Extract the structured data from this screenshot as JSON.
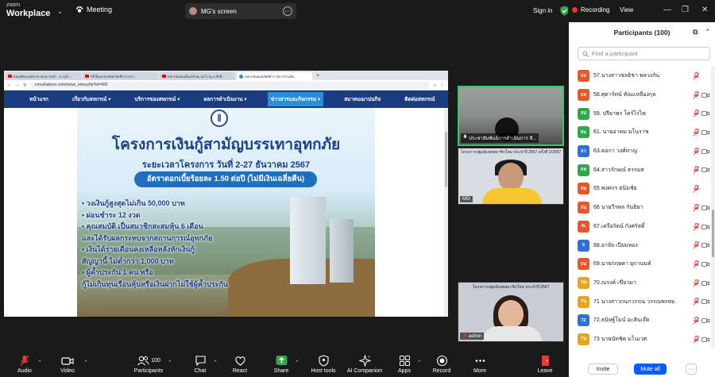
{
  "topbar": {
    "brand_small": "zoom",
    "brand_big": "Workplace",
    "meeting_label": "Meeting",
    "screen_label": "MG's screen",
    "signin_label": "Sign in"
  },
  "rightbar": {
    "recording_label": "Recording",
    "view_label": "View"
  },
  "browser": {
    "tabs": [
      {
        "label": "สอนเทือกเขตทราย สอนการเข้า - ยามน้ำ..."
      },
      {
        "label": "วิธีใช้และขอสมัครจับที่ว่าการกา..."
      },
      {
        "label": "สหกรณ์ออมเตือนได้ By ออโร Ep.5 สิ่งที่..."
      },
      {
        "label": "สหกรณ์ออมทรัพย์ข้าราชการส่วนท้อ..."
      }
    ],
    "url": "cmcahakorn.com/news_view.php?id=400",
    "nav": [
      {
        "label": "หน้าแรก"
      },
      {
        "label": "เกี่ยวกับสหกรณ์ ▾"
      },
      {
        "label": "บริการของสหกรณ์ ▾"
      },
      {
        "label": "ผลการดำเนินงาน ▾"
      },
      {
        "label": "ข่าวสารและกิจกรรม ▾"
      },
      {
        "label": "สมาคมฌาปนกิจ"
      },
      {
        "label": "ติดต่อสหกรณ์"
      }
    ]
  },
  "poster": {
    "title": "โครงการเงินกู้สามัญบรรเทาอุทกภัย",
    "period": "ระยะเวลาโครงการ วันที่ 2-27 ธันวาคม 2567",
    "rate": "อัตราดอกเบี้ยร้อยละ 1.50 ต่อปี (ไม่มีเงินเฉลี่ยคืน)",
    "bullets": [
      "• วงเงินกู้สูงสุดไม่เกิน 50,000  บาท",
      "• ผ่อนชำระ 12 งวด",
      "• คุณสมบัติ เป็นสมาชิกสะสมหุ้น 6 เดือน",
      "   และได้รับผลกระทบจากสถานการณ์อุทกภัย",
      "• เงินได้รายเดือนคงเหลือหลังหักเงินกู้",
      "   สัญญานี้  ไม่ต่ำกว่า 1,000 บาท",
      "• ผู้ค้ำประกัน 1 คน หรือ",
      "   กู้ไม่เกินทุนเรือนหุ้นหรือเงินฝากไม่ใช้ผู้ค้ำประกัน"
    ]
  },
  "tiles": {
    "t1_label": "ประชาสัมพันธ์การดำเนินการ สิ...",
    "t2_banner": "โครงการปฐมนิเทศสมาชิกใหม่ ประจำปี 2567 ครั้งที่ 2/2567",
    "t2_label": "MG",
    "t3_banner": "โครงการปฐมนิเทศสมาชิกใหม่ ประจำปี 2567",
    "t3_label": "admin"
  },
  "participants": {
    "title": "Participants (100)",
    "search_placeholder": "Find a participant",
    "rows": [
      {
        "badge": "5ห",
        "name": "57.นางสาวชลธิชา  พลวงกัน",
        "color": "#e8562c",
        "cam": false
      },
      {
        "badge": "5ห",
        "name": "58.ศุตาร์ทน์ ทัณแหลืองกุล",
        "color": "#e8562c",
        "cam": true
      },
      {
        "badge": "5ป",
        "name": "59. ปรียาพร โคร์ไร่ไพ",
        "color": "#2ea84a",
        "cam": true
      },
      {
        "badge": "6น",
        "name": "61. นายอาคม มโนราช",
        "color": "#2ea84a",
        "cam": true
      },
      {
        "badge": "6ว",
        "name": "63.คอกา วงศ์ทาญ",
        "color": "#2f6fd6",
        "cam": true
      },
      {
        "badge": "6ห",
        "name": "64.สาวรักษณ์ ธรรมส",
        "color": "#2ea84a",
        "cam": true
      },
      {
        "badge": "6พ",
        "name": "65.พงศกร  ธนิมช์ย",
        "color": "#e8562c",
        "cam": false
      },
      {
        "badge": "6น",
        "name": "66 นายวีรพล กันธิยา",
        "color": "#e8562c",
        "cam": true
      },
      {
        "badge": "6เ",
        "name": "67.เครือรัตน์ กังศรัสดิ์",
        "color": "#e8562c",
        "cam": true
      },
      {
        "badge": "6",
        "name": "68.อาจัย เปียมหอง",
        "color": "#2f6fd6",
        "cam": true
      },
      {
        "badge": "6น",
        "name": "69.นายกฤษดา ยุกานนท์",
        "color": "#e8562c",
        "cam": true
      },
      {
        "badge": "7ณ",
        "name": "70.ณรงค์ เขียวมา",
        "color": "#e8a41c",
        "cam": true
      },
      {
        "badge": "7น",
        "name": "71 นางสาวกนกวรรณ วรรณพรหม",
        "color": "#e8a41c",
        "cam": true
      },
      {
        "badge": "72",
        "name": "72.ธนิษฐ์โมน์ อะสินเจ๊ต",
        "color": "#2f6fd6",
        "cam": true
      },
      {
        "badge": "7น",
        "name": "73 นายนัทชิต  มโนเวศ",
        "color": "#e8a41c",
        "cam": true
      }
    ],
    "invite_label": "Invite",
    "muteall_label": "Mute all",
    "more_label": "···"
  },
  "toolbar": {
    "audio": "Audio",
    "video": "Video",
    "participants": "Participants",
    "participants_count": "100",
    "chat": "Chat",
    "react": "React",
    "share": "Share",
    "host_tools": "Host tools",
    "ai_companion": "AI Companion",
    "apps": "Apps",
    "record": "Record",
    "more": "More",
    "leave": "Leave"
  },
  "colors": {
    "share_green": "#2ea84a",
    "leave_red": "#e53935",
    "mute_blue": "#0b5cff",
    "site_nav": "#1a3d82"
  }
}
